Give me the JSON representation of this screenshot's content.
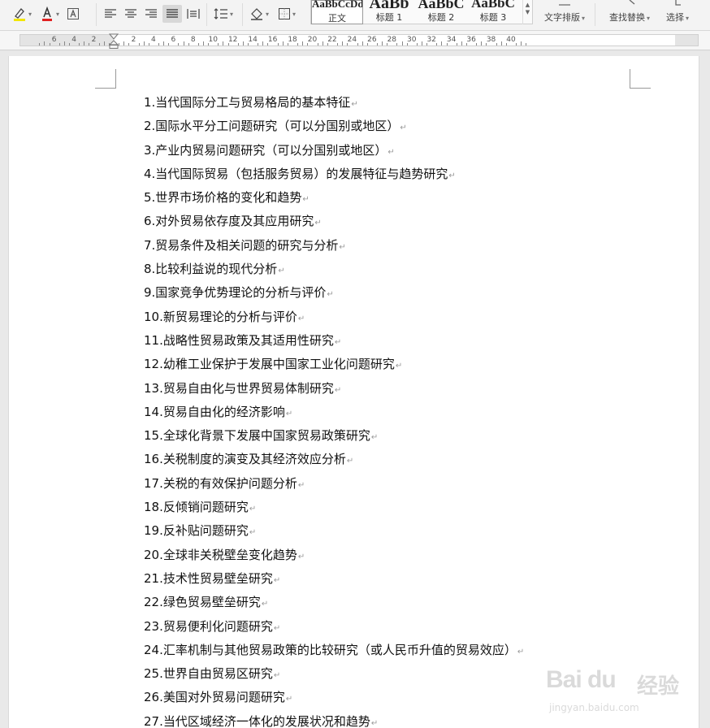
{
  "toolbar": {
    "styles": [
      {
        "preview": "AaBbCcDd",
        "label": "正文",
        "selected": true
      },
      {
        "preview": "AaBb",
        "label": "标题 1",
        "selected": false
      },
      {
        "preview": "AaBbC",
        "label": "标题 2",
        "selected": false
      },
      {
        "preview": "AaBbC",
        "label": "标题 3",
        "selected": false
      }
    ],
    "text_layout_label": "文字排版",
    "find_replace_label": "查找替换",
    "select_label": "选择",
    "highlight_color": "#f2e600",
    "font_color": "#e02020"
  },
  "ruler": {
    "labels": [
      "6",
      "4",
      "2",
      "2",
      "4",
      "6",
      "8",
      "10",
      "12",
      "14",
      "16",
      "18",
      "20",
      "22",
      "24",
      "26",
      "28",
      "30",
      "32",
      "34",
      "36",
      "38",
      "40"
    ]
  },
  "document": {
    "lines": [
      "1.当代国际分工与贸易格局的基本特征",
      "2.国际水平分工问题研究（可以分国别或地区）",
      "3.产业内贸易问题研究（可以分国别或地区）",
      "4.当代国际贸易（包括服务贸易）的发展特征与趋势研究",
      "5.世界市场价格的变化和趋势",
      "6.对外贸易依存度及其应用研究",
      "7.贸易条件及相关问题的研究与分析",
      "8.比较利益说的现代分析",
      "9.国家竞争优势理论的分析与评价",
      "10.新贸易理论的分析与评价",
      "11.战略性贸易政策及其适用性研究",
      "12.幼稚工业保护于发展中国家工业化问题研究",
      "13.贸易自由化与世界贸易体制研究",
      "14.贸易自由化的经济影响",
      "15.全球化背景下发展中国家贸易政策研究",
      "16.关税制度的演变及其经济效应分析",
      "17.关税的有效保护问题分析",
      "18.反倾销问题研究",
      "19.反补贴问题研究",
      "20.全球非关税壁垒变化趋势",
      "21.技术性贸易壁垒研究",
      "22.绿色贸易壁垒研究",
      "23.贸易便利化问题研究",
      "24.汇率机制与其他贸易政策的比较研究（或人民币升值的贸易效应）",
      "25.世界自由贸易区研究",
      "26.美国对外贸易问题研究",
      "27.当代区域经济一体化的发展状况和趋势"
    ],
    "paragraph_mark": "↵"
  },
  "watermark": {
    "logo": "Bai du",
    "jingyan": "经验",
    "url": "jingyan.baidu.com"
  }
}
